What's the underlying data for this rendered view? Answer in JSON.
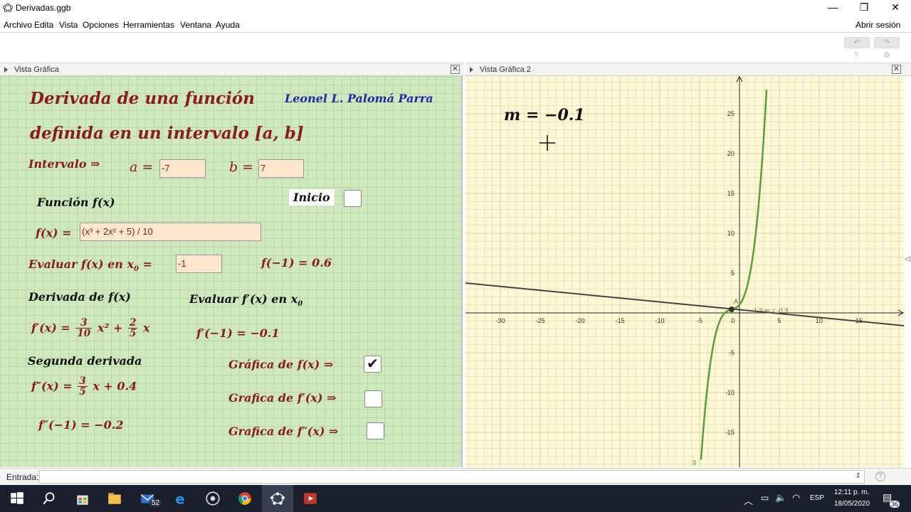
{
  "window": {
    "title": "Derivadas.ggb",
    "min": "—",
    "restore": "❐",
    "close": "✕"
  },
  "menu": {
    "items": [
      "Archivo",
      "Edita",
      "Vista",
      "Opciones",
      "Herramientas",
      "Ventana",
      "Ayuda"
    ],
    "login": "Abrir sesión"
  },
  "toolbar": {
    "undo": "↶",
    "redo": "↷",
    "help": "?",
    "settings": "⚙"
  },
  "left_view": {
    "title": "Vista Gráfica",
    "close": "✕"
  },
  "right_view": {
    "title": "Vista Gráfica 2",
    "close": "✕"
  },
  "panel": {
    "title1": "Derivada de una función",
    "author": "Leonel L. Palomá Parra",
    "title2": "definida en un intervalo [a, b]",
    "interval_label": "Intervalo ⇒",
    "a_label": "a =",
    "a_value": "-7",
    "b_label": "b =",
    "b_value": "7",
    "inicio": "Inicio",
    "funcion_label": "Función f(x)",
    "f_label": "f(x) =",
    "f_value": "(x³ + 2x² + 5) / 10",
    "evaluar_label": "Evaluar f(x)  en x",
    "evaluar_sub": "0",
    "evaluar_eq": "=",
    "x0_value": "-1",
    "f_result": "f(−1) = 0.6",
    "derivada_label": "Derivada de f(x)",
    "evaluar_deriv_label": "Evaluar f′(x) en x",
    "evaluar_deriv_sub": "0",
    "fp_lhs": "f′(x) =",
    "fp_frac1_num": "3",
    "fp_frac1_den": "10",
    "fp_term1": "x² +",
    "fp_frac2_num": "2",
    "fp_frac2_den": "5",
    "fp_term2": "x",
    "fp_result": "f′(−1) = −0.1",
    "segunda_label": "Segunda derivada",
    "fpp_lhs": "f″(x) =",
    "fpp_frac_num": "3",
    "fpp_frac_den": "5",
    "fpp_term": "x + 0.4",
    "fpp_result": "f″(−1) = −0.2",
    "graf_f": "Gráfica de f(x) ⇒",
    "graf_fp": "Grafica de f′(x) ⇒",
    "graf_fpp": "Grafica de f″(x) ⇒",
    "check_mark": "✔"
  },
  "graph": {
    "slope_text": "m = −0.1",
    "point_label": "A",
    "slope_annotation": "1.3 m = -0.3",
    "curve_label": "g",
    "curve_color": "#5a9e3c",
    "line_color": "#444444",
    "bg_color": "#fdf8d6",
    "x_ticks": [
      "-30",
      "-25",
      "-20",
      "-15",
      "-10",
      "-5",
      "0",
      "5",
      "10",
      "15"
    ],
    "y_ticks": [
      "25",
      "20",
      "15",
      "10",
      "5",
      "-5",
      "-10",
      "-15"
    ]
  },
  "input_bar": {
    "label": "Entrada:"
  },
  "taskbar": {
    "mail_badge": "52",
    "lang": "ESP",
    "time": "12:11 p. m.",
    "date": "18/05/2020",
    "notif": "36"
  }
}
